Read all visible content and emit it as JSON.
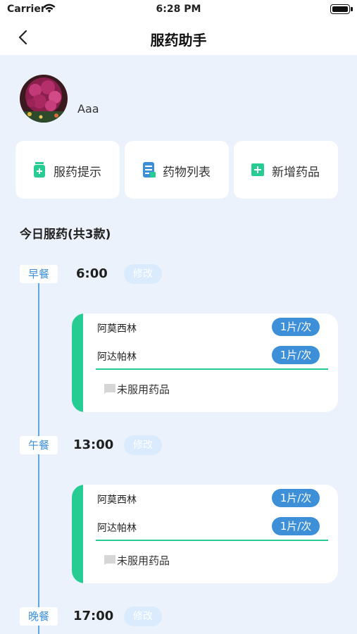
{
  "status": {
    "carrier": "Carrier",
    "time": "6:28 PM"
  },
  "nav": {
    "title": "服药助手"
  },
  "user": {
    "name": "Aaa"
  },
  "quick_actions": [
    {
      "label": "服药提示",
      "icon": "pill-bottle-icon"
    },
    {
      "label": "药物列表",
      "icon": "list-document-icon"
    },
    {
      "label": "新增药品",
      "icon": "plus-square-icon"
    }
  ],
  "section": {
    "title": "今日服药(共3款)"
  },
  "schedule": [
    {
      "meal": "早餐",
      "time": "6:00",
      "edit_label": "修改",
      "drugs": [
        {
          "name": "阿莫西林",
          "dose": "1片/次"
        },
        {
          "name": "阿达帕林",
          "dose": "1片/次"
        }
      ],
      "untaken_label": "未服用药品"
    },
    {
      "meal": "午餐",
      "time": "13:00",
      "edit_label": "修改",
      "drugs": [
        {
          "name": "阿莫西林",
          "dose": "1片/次"
        },
        {
          "name": "阿达帕林",
          "dose": "1片/次"
        }
      ],
      "untaken_label": "未服用药品"
    },
    {
      "meal": "晚餐",
      "time": "17:00",
      "edit_label": "修改"
    }
  ],
  "colors": {
    "accent_blue": "#3d8fd8",
    "accent_green": "#27cc92",
    "background": "#ecf2fb"
  }
}
